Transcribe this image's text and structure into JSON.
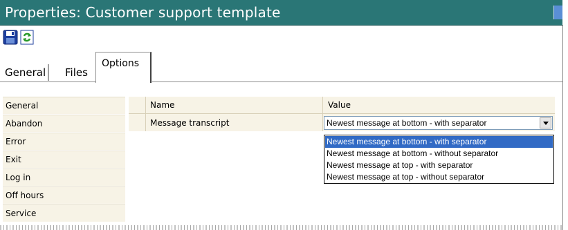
{
  "window": {
    "title": "Properties: Customer support template"
  },
  "toolbar": {
    "icons": [
      "save-icon",
      "refresh-icon"
    ]
  },
  "tabs": [
    {
      "label": "General"
    },
    {
      "label": "Files"
    },
    {
      "label": "Options",
      "selected": true
    }
  ],
  "sidebar": {
    "items": [
      {
        "label": "General"
      },
      {
        "label": "Abandon"
      },
      {
        "label": "Error"
      },
      {
        "label": "Exit"
      },
      {
        "label": "Log in"
      },
      {
        "label": "Off hours"
      },
      {
        "label": "Service"
      }
    ]
  },
  "grid": {
    "headers": {
      "name": "Name",
      "value": "Value"
    },
    "rows": [
      {
        "name": "Message transcript",
        "value": "Newest message at bottom - with separator"
      }
    ]
  },
  "dropdown": {
    "options": [
      {
        "label": "Newest message at bottom - with separator",
        "selected": true
      },
      {
        "label": "Newest message at bottom - without separator"
      },
      {
        "label": "Newest message at top - with separator"
      },
      {
        "label": "Newest message at top - without separator"
      }
    ]
  },
  "colors": {
    "title_bar": "#2a7676",
    "selection": "#316ac5",
    "panel_bg": "#f7f3e6"
  }
}
